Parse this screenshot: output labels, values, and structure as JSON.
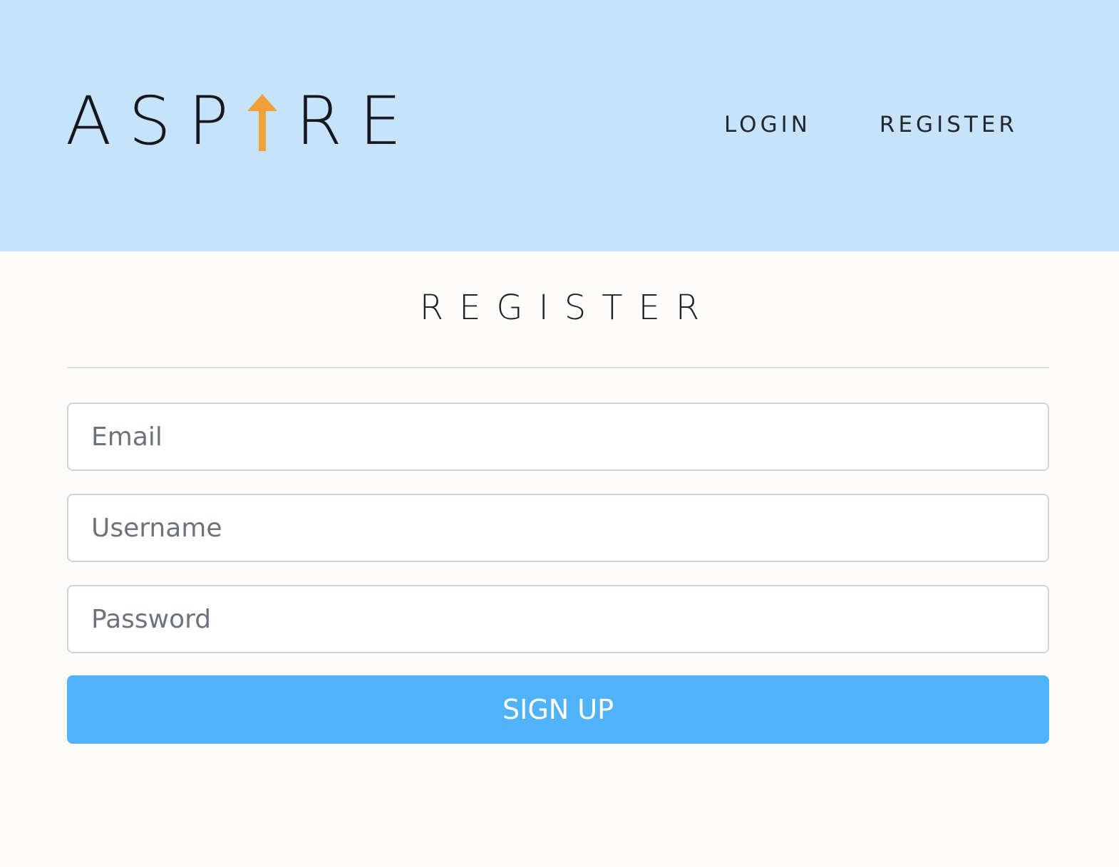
{
  "header": {
    "logo": {
      "text_before": "ASP",
      "text_after": "RE",
      "arrow_color": "#f0a038",
      "icon": "up-arrow-icon"
    },
    "nav": {
      "login_label": "LOGIN",
      "register_label": "REGISTER"
    },
    "background": "#c6e3fa"
  },
  "form": {
    "title": "REGISTER",
    "email_placeholder": "Email",
    "username_placeholder": "Username",
    "password_placeholder": "Password",
    "submit_label": "SIGN UP",
    "submit_color": "#50b2f8"
  },
  "page_background": "#fdfcf8"
}
